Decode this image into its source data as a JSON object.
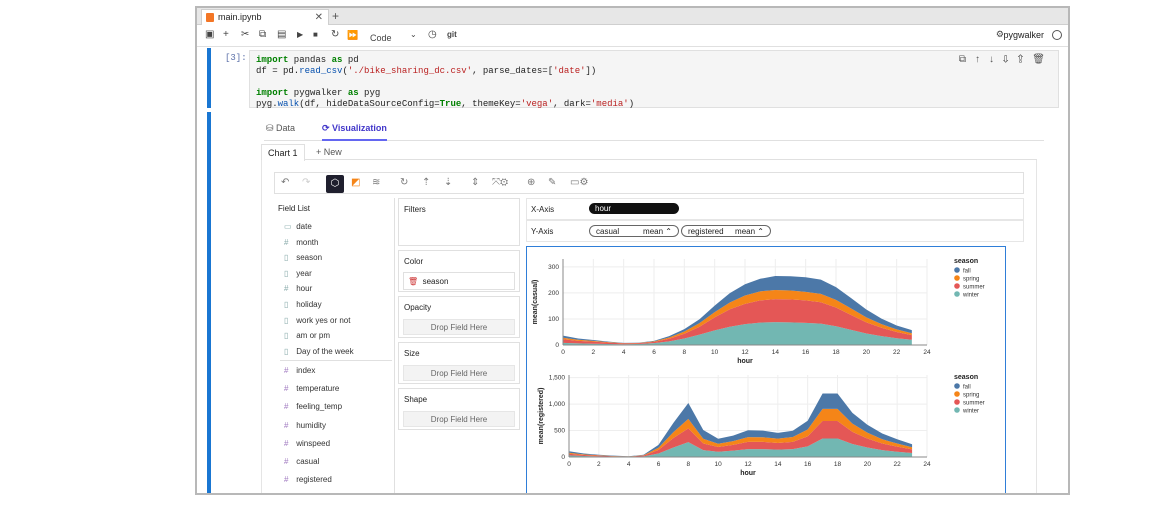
{
  "tab": {
    "title": "main.ipynb"
  },
  "toolbar": {
    "celltype": "Code",
    "git": "git",
    "kernel": "pygwalker"
  },
  "cell": {
    "prompt": "[3]:",
    "lines": [
      [
        "import pandas as pd"
      ],
      [
        "df = pd.read_csv('./bike_sharing_dc.csv', parse_dates=['date'])"
      ],
      [
        ""
      ],
      [
        "import pygwalker as pyg"
      ],
      [
        "pyg.walk(df, hideDataSourceConfig=True, themeKey='vega', dark='media')"
      ]
    ]
  },
  "viz": {
    "tabs": [
      "Data",
      "Visualization"
    ],
    "chart_tab": "Chart 1",
    "new_tab": "+ New",
    "field_list_title": "Field List",
    "dimensions": [
      "date",
      "month",
      "season",
      "year",
      "hour",
      "holiday",
      "work yes or not",
      "am or pm",
      "Day of the week"
    ],
    "measures": [
      "index",
      "temperature",
      "feeling_temp",
      "humidity",
      "winspeed",
      "casual",
      "registered"
    ],
    "filters_label": "Filters",
    "color_label": "Color",
    "color_field": "season",
    "opacity_label": "Opacity",
    "size_label": "Size",
    "shape_label": "Shape",
    "drop_text": "Drop Field Here",
    "x_axis_label": "X-Axis",
    "x_field": "hour",
    "y_axis_label": "Y-Axis",
    "y_fields": [
      {
        "name": "casual",
        "agg": "mean"
      },
      {
        "name": "registered",
        "agg": "mean"
      }
    ]
  },
  "colors": {
    "fall": "#4c78a8",
    "spring": "#f58518",
    "summer": "#e45756",
    "winter": "#72b7b2",
    "accent": "#4338ca"
  },
  "chart_data": [
    {
      "type": "area",
      "stacked": true,
      "xlabel": "hour",
      "ylabel": "mean(casual)",
      "legend_title": "season",
      "legend_position": "right",
      "x": [
        0,
        1,
        2,
        3,
        4,
        5,
        6,
        7,
        8,
        9,
        10,
        11,
        12,
        13,
        14,
        15,
        16,
        17,
        18,
        19,
        20,
        21,
        22,
        23
      ],
      "xticks": [
        0,
        2,
        4,
        6,
        8,
        10,
        12,
        14,
        16,
        18,
        20,
        22,
        24
      ],
      "yticks": [
        0,
        100,
        200,
        300
      ],
      "ylim": [
        0,
        330
      ],
      "xlim": [
        0,
        24
      ],
      "series": [
        {
          "name": "fall",
          "values": [
            8,
            5,
            3,
            2,
            1,
            1,
            2,
            5,
            9,
            15,
            25,
            36,
            43,
            48,
            54,
            55,
            56,
            55,
            49,
            40,
            30,
            21,
            15,
            12
          ]
        },
        {
          "name": "spring",
          "values": [
            6,
            4,
            3,
            2,
            1,
            1,
            2,
            5,
            9,
            14,
            20,
            26,
            32,
            35,
            35,
            34,
            33,
            32,
            29,
            25,
            19,
            14,
            10,
            7
          ]
        },
        {
          "name": "summer",
          "values": [
            14,
            10,
            8,
            5,
            3,
            3,
            5,
            10,
            18,
            30,
            50,
            67,
            78,
            85,
            88,
            88,
            86,
            82,
            72,
            57,
            43,
            32,
            24,
            18
          ]
        },
        {
          "name": "winter",
          "values": [
            8,
            6,
            5,
            4,
            3,
            4,
            7,
            14,
            25,
            40,
            56,
            70,
            80,
            86,
            88,
            87,
            85,
            82,
            72,
            58,
            44,
            34,
            26,
            20
          ]
        }
      ]
    },
    {
      "type": "area",
      "stacked": true,
      "xlabel": "hour",
      "ylabel": "mean(registered)",
      "legend_title": "season",
      "legend_position": "right",
      "x": [
        0,
        1,
        2,
        3,
        4,
        5,
        6,
        7,
        8,
        9,
        10,
        11,
        12,
        13,
        14,
        15,
        16,
        17,
        18,
        19,
        20,
        21,
        22,
        23
      ],
      "xticks": [
        0,
        2,
        4,
        6,
        8,
        10,
        12,
        14,
        16,
        18,
        20,
        22,
        24
      ],
      "yticks": [
        0,
        500,
        1000,
        1500
      ],
      "ytick_labels": [
        "0",
        "500",
        "1,000",
        "1,500"
      ],
      "ylim": [
        0,
        1550
      ],
      "xlim": [
        0,
        24
      ],
      "series": [
        {
          "name": "fall",
          "values": [
            28,
            17,
            11,
            6,
            4,
            10,
            55,
            175,
            300,
            165,
            95,
            105,
            130,
            125,
            110,
            120,
            165,
            290,
            290,
            205,
            150,
            110,
            80,
            55
          ]
        },
        {
          "name": "spring",
          "values": [
            18,
            11,
            7,
            4,
            2,
            7,
            40,
            110,
            180,
            90,
            60,
            70,
            90,
            88,
            82,
            92,
            130,
            230,
            230,
            155,
            110,
            80,
            60,
            40
          ]
        },
        {
          "name": "summer",
          "values": [
            32,
            20,
            13,
            8,
            5,
            14,
            70,
            180,
            260,
            125,
            90,
            110,
            135,
            135,
            125,
            135,
            190,
            330,
            330,
            230,
            170,
            125,
            95,
            70
          ]
        },
        {
          "name": "winter",
          "values": [
            30,
            18,
            12,
            7,
            4,
            12,
            65,
            180,
            280,
            130,
            100,
            120,
            150,
            150,
            140,
            150,
            200,
            350,
            350,
            245,
            180,
            130,
            100,
            75
          ]
        }
      ]
    }
  ]
}
